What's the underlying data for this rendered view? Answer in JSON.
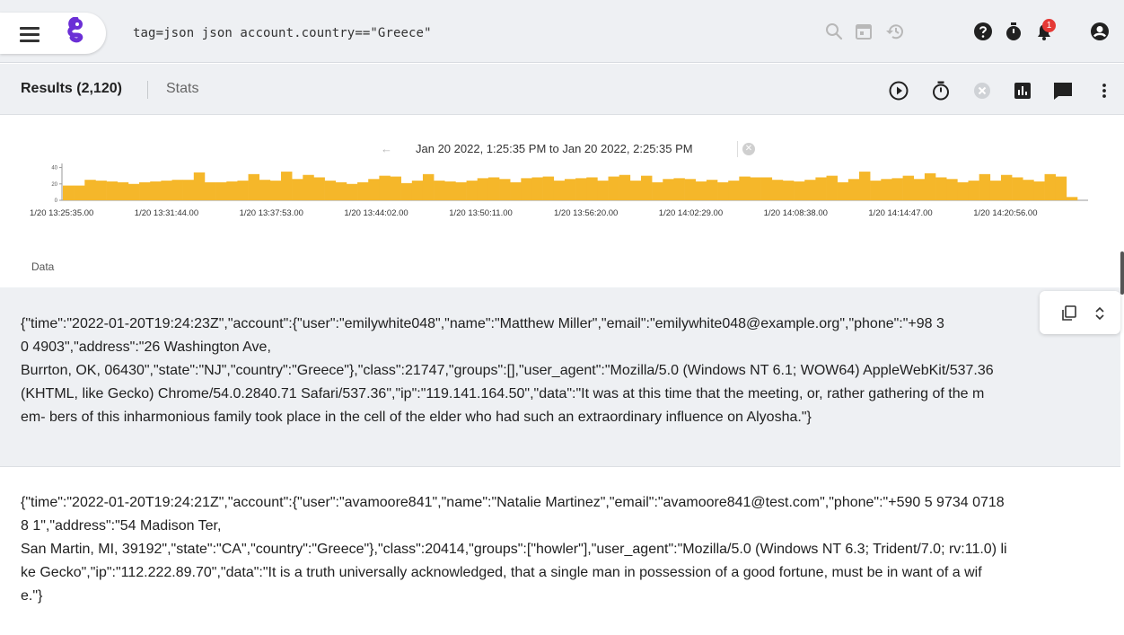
{
  "header": {
    "query": "tag=json json account.country==\"Greece\"",
    "notification_count": "1",
    "icons": [
      "menu-icon",
      "logo-icon",
      "search-icon",
      "calendar-icon",
      "history-icon",
      "help-icon",
      "timer-icon",
      "notifications-icon",
      "account-icon"
    ]
  },
  "results_bar": {
    "results_label": "Results (2,120)",
    "stats_label": "Stats",
    "icons": [
      "play-icon",
      "stopwatch-icon",
      "cancel-icon",
      "chart-icon",
      "comment-icon",
      "more-vert-icon"
    ]
  },
  "time_range": {
    "back_arrow": "←",
    "text": "Jan 20 2022, 1:25:35 PM to Jan 20 2022, 2:25:35 PM",
    "clear": "✕"
  },
  "chart_data": {
    "type": "bar",
    "bar_color": "#f5b72a",
    "y_ticks": [
      "40",
      "20",
      "0"
    ],
    "ylim": [
      0,
      45
    ],
    "x_tick_labels": [
      "1/20 13:25:35.00",
      "1/20 13:31:44.00",
      "1/20 13:37:53.00",
      "1/20 13:44:02.00",
      "1/20 13:50:11.00",
      "1/20 13:56:20.00",
      "1/20 14:02:29.00",
      "1/20 14:08:38.00",
      "1/20 14:14:47.00",
      "1/20 14:20:56.00"
    ],
    "values": [
      18,
      18,
      25,
      24,
      23,
      22,
      20,
      22,
      23,
      24,
      25,
      25,
      34,
      22,
      22,
      23,
      24,
      32,
      25,
      24,
      35,
      26,
      31,
      28,
      24,
      22,
      20,
      22,
      26,
      30,
      29,
      21,
      24,
      32,
      24,
      23,
      22,
      24,
      27,
      28,
      26,
      22,
      27,
      28,
      29,
      24,
      26,
      27,
      28,
      24,
      29,
      31,
      24,
      30,
      22,
      26,
      27,
      26,
      23,
      25,
      22,
      24,
      29,
      28,
      28,
      25,
      24,
      23,
      25,
      28,
      30,
      22,
      26,
      35,
      24,
      26,
      27,
      30,
      26,
      33,
      28,
      26,
      22,
      24,
      32,
      24,
      31,
      28,
      25,
      23,
      32,
      29,
      4
    ]
  },
  "data_section": {
    "label": "Data",
    "records": [
      "{\"time\":\"2022-01-20T19:24:23Z\",\"account\":{\"user\":\"emilywhite048\",\"name\":\"Matthew Miller\",\"email\":\"emilywhite048@example.org\",\"phone\":\"+98 3\n0 4903\",\"address\":\"26 Washington Ave,\nBurrton, OK, 06430\",\"state\":\"NJ\",\"country\":\"Greece\"},\"class\":21747,\"groups\":[],\"user_agent\":\"Mozilla/5.0 (Windows NT 6.1; WOW64) AppleWebKit/537.36\n(KHTML, like Gecko) Chrome/54.0.2840.71 Safari/537.36\",\"ip\":\"119.141.164.50\",\"data\":\"It was at this time that the meeting, or, rather gathering of the m\nem- bers of this inharmonious family took place in the cell of the elder who had such an extraordinary influence on Alyosha.\"}",
      "{\"time\":\"2022-01-20T19:24:21Z\",\"account\":{\"user\":\"avamoore841\",\"name\":\"Natalie Martinez\",\"email\":\"avamoore841@test.com\",\"phone\":\"+590 5 9734 0718\n8 1\",\"address\":\"54 Madison Ter,\nSan Martin, MI, 39192\",\"state\":\"CA\",\"country\":\"Greece\"},\"class\":20414,\"groups\":[\"howler\"],\"user_agent\":\"Mozilla/5.0 (Windows NT 6.3; Trident/7.0; rv:11.0) li\nke Gecko\",\"ip\":\"112.222.89.70\",\"data\":\"It is a truth universally acknowledged, that a single man in possession of a good fortune, must be in want of a wif\ne.\"}"
    ]
  },
  "colors": {
    "bar": "#f5b72a",
    "logo": "#6b2fd6",
    "notification_badge": "#e53935"
  }
}
